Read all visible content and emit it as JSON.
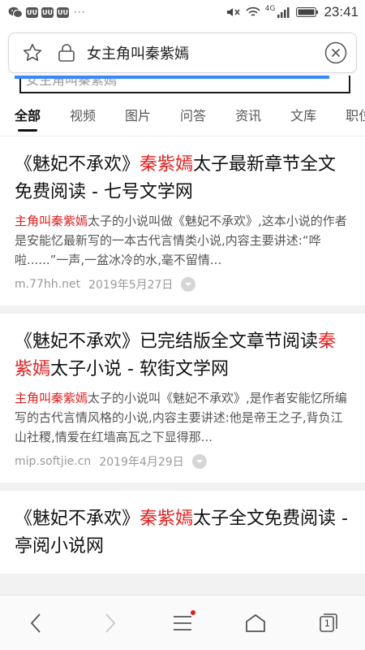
{
  "status_bar": {
    "app_icons": [
      "UU",
      "UU",
      "UU"
    ],
    "more": "···",
    "network": "4G",
    "time": "23:41"
  },
  "search": {
    "query": "女主角叫秦紫嫣"
  },
  "peek_text": "女主角叫秦紫嫣",
  "tabs": [
    {
      "label": "全部",
      "active": true
    },
    {
      "label": "视频"
    },
    {
      "label": "图片"
    },
    {
      "label": "问答"
    },
    {
      "label": "资讯"
    },
    {
      "label": "文库"
    },
    {
      "label": "职位"
    }
  ],
  "results": [
    {
      "title_pre": "《魅妃不承欢》",
      "title_hl": "秦紫嫣",
      "title_post": "太子最新章节全文免费阅读 - 七号文学网",
      "snippet_hl": "主角叫秦紫嫣",
      "snippet": "太子的小说叫做《魅妃不承欢》,这本小说的作者是安能忆最新写的一本古代言情类小说,内容主要讲述:“哗啦......”一声,一盆冰冷的水,毫不留情...",
      "domain": "m.77hh.net",
      "date": "2019年5月27日"
    },
    {
      "title_pre": "《魅妃不承欢》已完结版全文章节阅读",
      "title_hl": "秦紫嫣",
      "title_post": "太子小说 - 软街文学网",
      "snippet_hl": "主角叫秦紫嫣",
      "snippet": "太子的小说叫《魅妃不承欢》,是作者安能忆所编写的古代言情风格的小说,内容主要讲述:他是帝王之子,背负江山社稷,情爱在红墙高瓦之下显得那...",
      "domain": "mip.softjie.cn",
      "date": "2019年4月29日"
    },
    {
      "title_pre": "《魅妃不承欢》",
      "title_hl": "秦紫嫣",
      "title_post": "太子全文免费阅读 - 亭阅小说网",
      "snippet_hl": "",
      "snippet": "",
      "domain": "",
      "date": ""
    }
  ],
  "bottom_nav": {
    "tab_count": "1"
  },
  "colors": {
    "highlight": "#e02020",
    "accent_blue": "#3a86ff"
  }
}
